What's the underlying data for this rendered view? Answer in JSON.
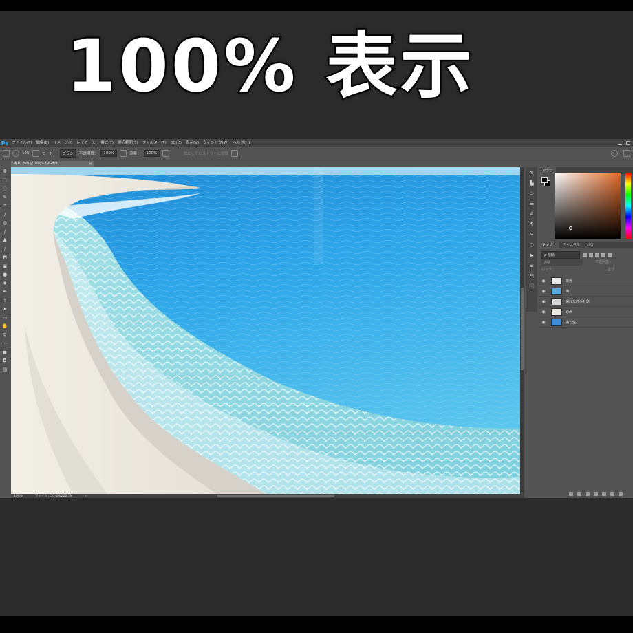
{
  "banner": {
    "text": "100% 表示"
  },
  "app": {
    "logo": "Ps"
  },
  "menu": [
    "ファイル(F)",
    "編集(E)",
    "イメージ(I)",
    "レイヤー(L)",
    "書式(Y)",
    "選択範囲(S)",
    "フィルター(T)",
    "3D(D)",
    "表示(V)",
    "ウィンドウ(W)",
    "ヘルプ(H)"
  ],
  "options": {
    "brush_size": "125",
    "mode_label": "モード：",
    "mode_value": "ブラシ",
    "opacity_label": "不透明度：",
    "opacity_value": "100%",
    "flow_label": "流量：",
    "flow_value": "100%",
    "history_label": "消去してヒストリーに記録"
  },
  "document": {
    "tab_title": "海10.psd @ 100% (RGB/8)",
    "close": "×"
  },
  "status": {
    "zoom": "100%",
    "file_info": "ファイル : 50.6M/266.3M",
    "arrow": "›"
  },
  "panels": {
    "top_tab": "カラー",
    "tabs": [
      "レイヤー",
      "チャンネル",
      "パス"
    ],
    "filter_value": "ρ 種類",
    "blend_mode": "通常",
    "opacity_label": "不透明度 :",
    "lock_label": "ロック :",
    "fill_label": "塗り :"
  },
  "layers": [
    {
      "name": "陽光",
      "thumb_color": "#e9e9e9"
    },
    {
      "name": "海",
      "thumb_color": "#5aa8e0"
    },
    {
      "name": "濡れた砂浜と影",
      "thumb_color": "#d6dbd9"
    },
    {
      "name": "砂浜",
      "thumb_color": "#ece8e0"
    },
    {
      "name": "海と空",
      "thumb_color": "#3f8fd8"
    }
  ],
  "colors": {
    "accent": "#31a8ff",
    "sea_deep": "#1e88d8",
    "sea_mid": "#3fb0ea",
    "sea_shallow": "#8fd8e4",
    "foam": "#f4fafb",
    "sand": "#ece8de",
    "wet_sand": "#cfcbc2"
  }
}
